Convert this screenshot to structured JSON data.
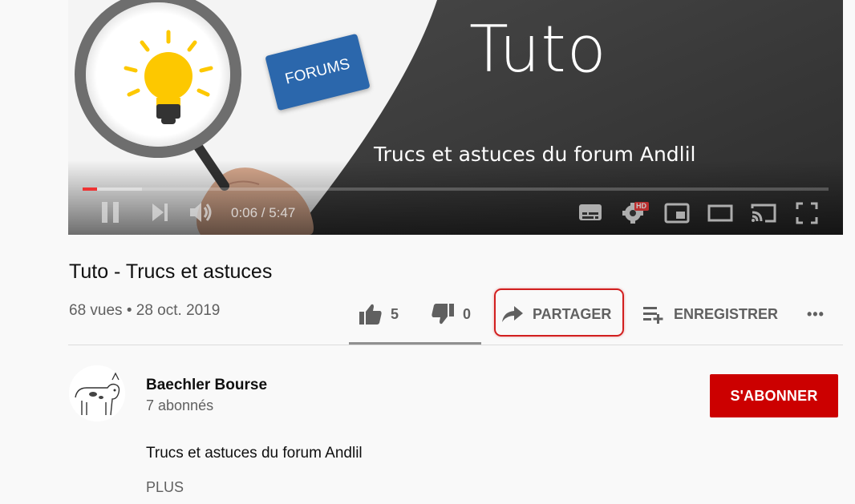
{
  "player": {
    "thumbnail_title": "Tuto",
    "thumbnail_subtitle": "Trucs et astuces du forum Andlil",
    "card_label": "FORUMS",
    "time_display": "0:06 / 5:47",
    "progress_fraction": 0.019,
    "loaded_fraction": 0.08,
    "quality_badge": "HD",
    "accent_color": "#ee3333",
    "icons": [
      "play-pause-icon",
      "next-icon",
      "volume-icon",
      "subtitles-icon",
      "settings-icon",
      "miniplayer-icon",
      "theater-icon",
      "cast-icon",
      "fullscreen-icon"
    ]
  },
  "video": {
    "title": "Tuto - Trucs et astuces",
    "meta": "68 vues • 28 oct. 2019"
  },
  "actions": {
    "likes": "5",
    "dislikes": "0",
    "share_label": "PARTAGER",
    "save_label": "ENREGISTRER",
    "more_label": "•••"
  },
  "channel": {
    "name": "Baechler Bourse",
    "subscribers": "7 abonnés",
    "subscribe_label": "S'ABONNER",
    "subscribe_color": "#cc0000"
  },
  "description": {
    "text": "Trucs et astuces du forum Andlil",
    "more_label": "PLUS"
  }
}
